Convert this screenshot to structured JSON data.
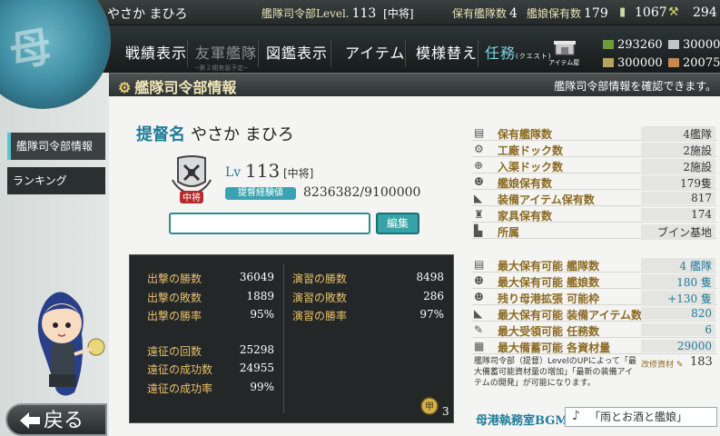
{
  "header": {
    "admiral_name": "やさか まひろ",
    "hq_level_label": "艦隊司令部Level.",
    "hq_level": "113",
    "rank_bracket": "[中将]",
    "fleet_count_label": "保有艦隊数",
    "fleet_count": "4",
    "ship_count_label": "艦娘保有数",
    "ship_count": "179",
    "bucket": "1067",
    "devmat_partial": "294"
  },
  "nav": {
    "items": [
      "戦績表示",
      "友軍艦隊",
      "図鑑表示",
      "アイテム",
      "模様替え"
    ],
    "friend_fleet_sub": "─第２期実装予定─",
    "quest": "任務",
    "quest_sub": "(クエスト)",
    "item_shop": "アイテム屋"
  },
  "resources": {
    "fuel": "293260",
    "ammo": "300000",
    "steel": "30000",
    "bauxite": "20075"
  },
  "titlebar": {
    "title": "艦隊司令部情報",
    "hint": "艦隊司令部情報を確認できます。"
  },
  "sidebar": {
    "tabs": [
      "艦隊司令部情報",
      "ランキング"
    ],
    "back": "戻る"
  },
  "profile": {
    "admiral_label": "提督名",
    "admiral_name": "やさか まひろ",
    "lv_label": "Lv",
    "level": "113",
    "rank": "[中将]",
    "rank_badge": "中将",
    "exp_label": "提督経験値",
    "exp_value": "8236382/9100000",
    "comment_value": "",
    "edit_button": "編集"
  },
  "battle": {
    "sortie": [
      {
        "label": "出撃の勝数",
        "value": "36049"
      },
      {
        "label": "出撃の敗数",
        "value": "1889"
      },
      {
        "label": "出撃の勝率",
        "value": "95%"
      }
    ],
    "exercise": [
      {
        "label": "演習の勝数",
        "value": "8498"
      },
      {
        "label": "演習の敗数",
        "value": "286"
      },
      {
        "label": "演習の勝率",
        "value": "97%"
      }
    ],
    "expedition": [
      {
        "label": "遠征の回数",
        "value": "25298"
      },
      {
        "label": "遠征の成功数",
        "value": "24955"
      },
      {
        "label": "遠征の成功率",
        "value": "99%"
      }
    ],
    "medal_count": "3"
  },
  "stats": {
    "current": [
      {
        "label": "保有艦隊数",
        "value": "4艦隊"
      },
      {
        "label": "工廠ドック数",
        "value": "2施設"
      },
      {
        "label": "入渠ドック数",
        "value": "2施設"
      },
      {
        "label": "艦娘保有数",
        "value": "179隻"
      },
      {
        "label": "装備アイテム保有数",
        "value": "817"
      },
      {
        "label": "家具保有数",
        "value": "174"
      },
      {
        "label": "所属",
        "value": "ブイン基地"
      }
    ],
    "max": [
      {
        "label": "最大保有可能 艦隊数",
        "value": "4 艦隊"
      },
      {
        "label": "最大保有可能 艦娘数",
        "value": "180 隻"
      },
      {
        "label": "残り母港拡張 可能枠",
        "value": "+130 隻"
      },
      {
        "label": "最大保有可能 装備アイテム数",
        "value": "820"
      },
      {
        "label": "最大受領可能 任務数",
        "value": "6"
      },
      {
        "label": "最大備蓄可能 各資材量",
        "value": "29000"
      }
    ],
    "note": "艦隊司令部（提督）LevelのUPによって「最大備蓄可能資材量の増加」「最新の装備アイテムの開発」が可能になります。",
    "upgrade_label": "改修資材",
    "upgrade_value": "183"
  },
  "bgm": {
    "label": "母港執務室BGM",
    "track": "「雨とお酒と艦娘」"
  },
  "colors": {
    "accent_teal": "#1f7c9a",
    "gold_label": "#8b6a22",
    "stat_label_dark": "#e8c06a",
    "header_bg": "#24292a"
  }
}
